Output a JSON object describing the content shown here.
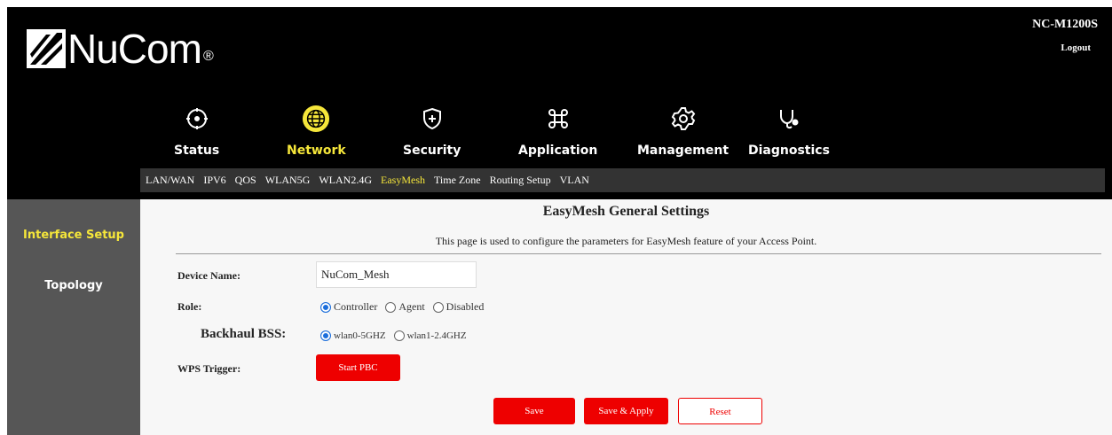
{
  "brand": {
    "name": "NuCom",
    "registered": "®"
  },
  "model": "NC-M1200S",
  "logout_label": "Logout",
  "colors": {
    "accent": "#f5e63a",
    "primary_button": "#ee0000",
    "header_bg": "#000000",
    "sidebar_bg": "#565656"
  },
  "main_nav": [
    {
      "label": "Status",
      "icon": "status-crosshair-icon",
      "active": false
    },
    {
      "label": "Network",
      "icon": "globe-icon",
      "active": true
    },
    {
      "label": "Security",
      "icon": "shield-plus-icon",
      "active": false
    },
    {
      "label": "Application",
      "icon": "command-icon",
      "active": false
    },
    {
      "label": "Management",
      "icon": "gear-icon",
      "active": false
    },
    {
      "label": "Diagnostics",
      "icon": "stethoscope-icon",
      "active": false
    }
  ],
  "sub_nav": [
    {
      "label": "LAN/WAN",
      "active": false
    },
    {
      "label": "IPV6",
      "active": false
    },
    {
      "label": "QOS",
      "active": false
    },
    {
      "label": "WLAN5G",
      "active": false
    },
    {
      "label": "WLAN2.4G",
      "active": false
    },
    {
      "label": "EasyMesh",
      "active": true
    },
    {
      "label": "Time Zone",
      "active": false
    },
    {
      "label": "Routing Setup",
      "active": false
    },
    {
      "label": "VLAN",
      "active": false
    }
  ],
  "sidebar": [
    {
      "label": "Interface Setup",
      "active": true
    },
    {
      "label": "Topology",
      "active": false
    }
  ],
  "page": {
    "title": "EasyMesh General Settings",
    "description": "This page is used to configure the parameters for EasyMesh feature of your Access Point."
  },
  "form": {
    "device_name": {
      "label": "Device Name:",
      "value": "NuCom_Mesh"
    },
    "role": {
      "label": "Role:",
      "options": [
        "Controller",
        "Agent",
        "Disabled"
      ],
      "selected": "Controller"
    },
    "backhaul": {
      "label": "Backhaul BSS:",
      "options": [
        "wlan0-5GHZ",
        "wlan1-2.4GHZ"
      ],
      "selected": "wlan0-5GHZ"
    },
    "wps": {
      "label": "WPS Trigger:",
      "button": "Start PBC"
    }
  },
  "actions": {
    "save": "Save",
    "save_apply": "Save & Apply",
    "reset": "Reset"
  }
}
